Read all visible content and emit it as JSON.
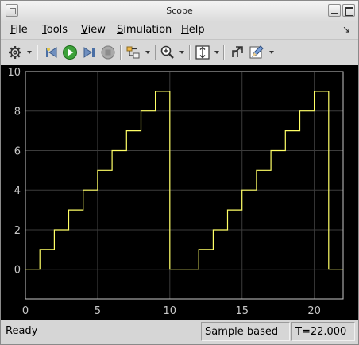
{
  "window": {
    "title": "Scope"
  },
  "menu": [
    "File",
    "Tools",
    "View",
    "Simulation",
    "Help"
  ],
  "menu_mnemonics": [
    "F",
    "T",
    "V",
    "S",
    "H"
  ],
  "toolbar": [
    {
      "icon": "gear-icon",
      "dropdown": true
    },
    {
      "icon": "step-back-icon"
    },
    {
      "icon": "run-icon"
    },
    {
      "icon": "step-forward-icon"
    },
    {
      "icon": "stop-icon"
    },
    {
      "icon": "signal-select-icon",
      "dropdown": true
    },
    {
      "icon": "zoom-in-icon",
      "dropdown": true
    },
    {
      "icon": "autoscale-icon",
      "dropdown": true
    },
    {
      "icon": "highlight-block-icon"
    },
    {
      "icon": "style-edit-icon",
      "dropdown": true
    }
  ],
  "chart_data": {
    "type": "line",
    "series": [
      {
        "x": [
          0,
          1,
          1,
          2,
          2,
          3,
          3,
          4,
          4,
          5,
          5,
          6,
          6,
          7,
          7,
          8,
          8,
          9,
          9,
          10,
          10,
          12,
          12,
          13,
          13,
          14,
          14,
          15,
          15,
          16,
          16,
          17,
          17,
          18,
          18,
          19,
          19,
          20,
          20,
          21,
          21,
          22
        ],
        "y": [
          0,
          0,
          1,
          1,
          2,
          2,
          3,
          3,
          4,
          4,
          5,
          5,
          6,
          6,
          7,
          7,
          8,
          8,
          9,
          9,
          0,
          0,
          1,
          1,
          2,
          2,
          3,
          3,
          4,
          4,
          5,
          5,
          6,
          6,
          7,
          7,
          8,
          8,
          9,
          9,
          0,
          0
        ]
      }
    ],
    "xlim": [
      0,
      22
    ],
    "ylim": [
      -1.5,
      10
    ],
    "xticks": [
      "0",
      "5",
      "10",
      "15",
      "20"
    ],
    "yticks": [
      "0",
      "2",
      "4",
      "6",
      "8",
      "10"
    ],
    "grid": true,
    "colors": {
      "background": "#000000",
      "grid": "#3c3c3c",
      "axes": "#c8c8c8",
      "line": "#ffff66"
    }
  },
  "status": {
    "state": "Ready",
    "mode": "Sample based",
    "time": "T=22.000"
  }
}
